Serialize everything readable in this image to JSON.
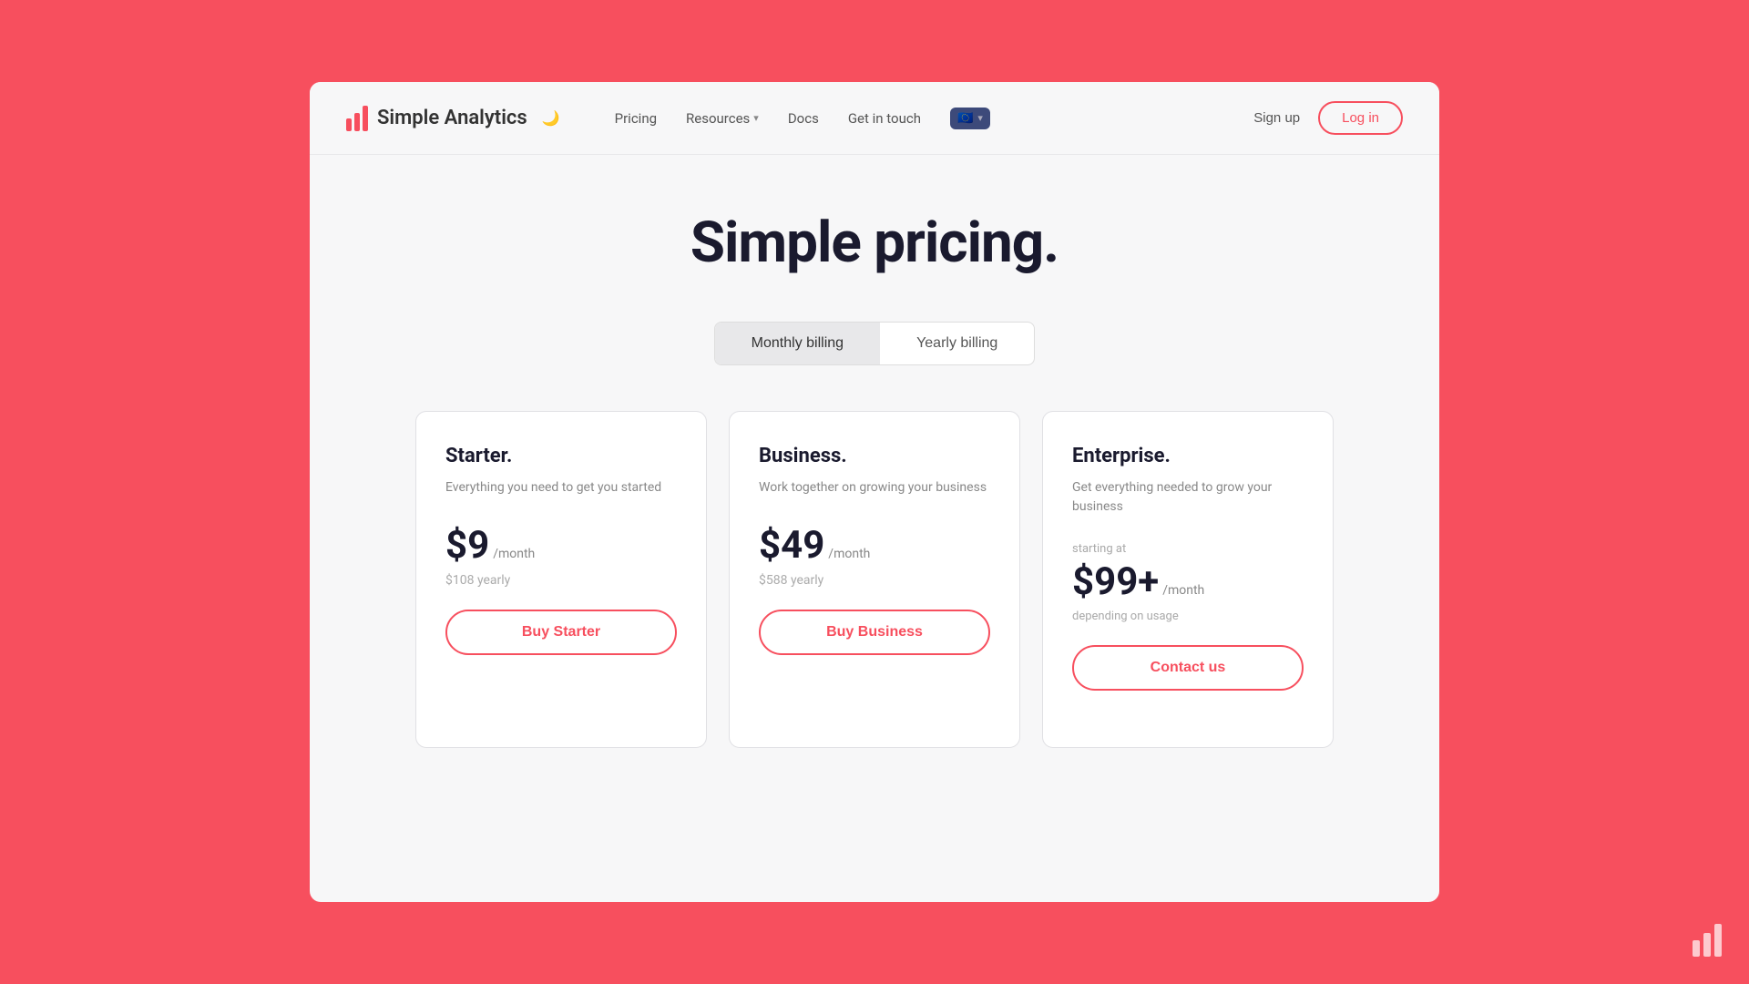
{
  "page": {
    "background_color": "#f74f5e",
    "title": "Simple pricing."
  },
  "navbar": {
    "logo": {
      "text": "Simple Analytics",
      "icon_alt": "bar-chart-logo"
    },
    "links": [
      {
        "label": "Pricing",
        "has_dropdown": false
      },
      {
        "label": "Resources",
        "has_dropdown": true
      },
      {
        "label": "Docs",
        "has_dropdown": false
      },
      {
        "label": "Get in touch",
        "has_dropdown": false
      }
    ],
    "eu_badge": {
      "icon": "🇪🇺",
      "has_dropdown": true
    },
    "actions": {
      "sign_up": "Sign up",
      "log_in": "Log in"
    }
  },
  "billing": {
    "monthly_label": "Monthly billing",
    "yearly_label": "Yearly billing",
    "active": "monthly"
  },
  "plans": [
    {
      "name": "Starter.",
      "description": "Everything you need to get you started",
      "starting_at": "",
      "price": "$9",
      "period": "/month",
      "yearly_price": "$108 yearly",
      "depending": "",
      "button_label": "Buy Starter"
    },
    {
      "name": "Business.",
      "description": "Work together on growing your business",
      "starting_at": "",
      "price": "$49",
      "period": "/month",
      "yearly_price": "$588 yearly",
      "depending": "",
      "button_label": "Buy Business"
    },
    {
      "name": "Enterprise.",
      "description": "Get everything needed to grow your business",
      "starting_at": "starting at",
      "price": "$99+",
      "period": "/month",
      "yearly_price": "",
      "depending": "depending on usage",
      "button_label": "Contact us"
    }
  ]
}
